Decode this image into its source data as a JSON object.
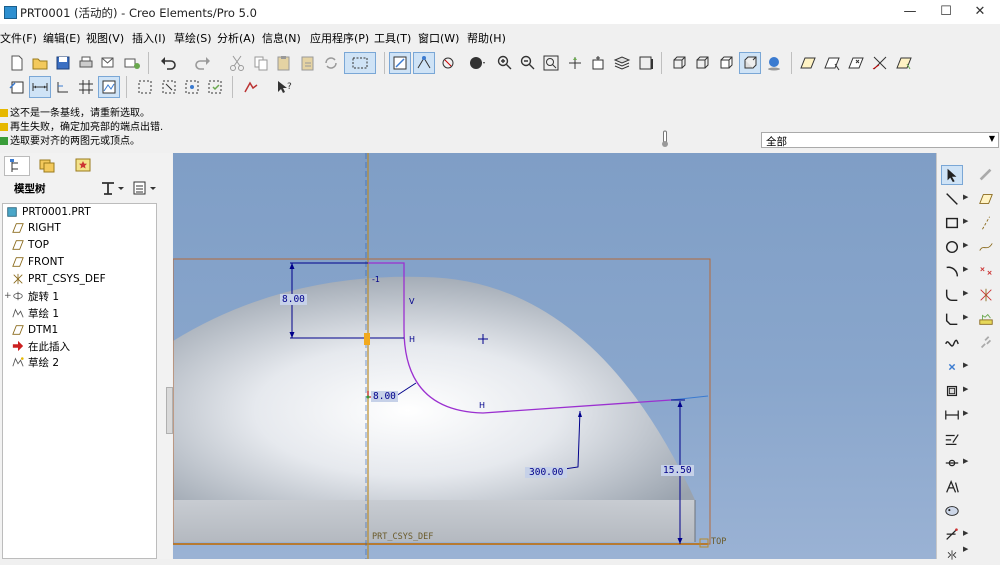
{
  "window": {
    "title": "PRT0001 (活动的) - Creo Elements/Pro 5.0"
  },
  "menu": [
    "文件(F)",
    "编辑(E)",
    "视图(V)",
    "插入(I)",
    "草绘(S)",
    "分析(A)",
    "信息(N)",
    "应用程序(P)",
    "工具(T)",
    "窗口(W)",
    "帮助(H)"
  ],
  "messages": [
    "这不是一条基线，请重新选取。",
    "再生失败，确定加亮部的端点出错.",
    "选取要对齐的两图元或顶点。"
  ],
  "filter": {
    "value": "全部"
  },
  "model_tree": {
    "label": "模型树",
    "items": [
      "PRT0001.PRT",
      "RIGHT",
      "TOP",
      "FRONT",
      "PRT_CSYS_DEF",
      "旋转 1",
      "草绘 1",
      "DTM1",
      "在此插入",
      "草绘 2"
    ]
  },
  "sketch": {
    "dims": [
      "8.00",
      "8.00",
      "300.00",
      "15.50"
    ],
    "constraints": [
      "V",
      "H",
      "H",
      "-1"
    ],
    "labels": {
      "csys": "PRT_CSYS_DEF",
      "plane": "TOP"
    }
  },
  "colors": {
    "accent": "#3b7bd0",
    "dim": "#00008b",
    "sketch": "#9b30d0",
    "datum": "#b88a2a"
  }
}
